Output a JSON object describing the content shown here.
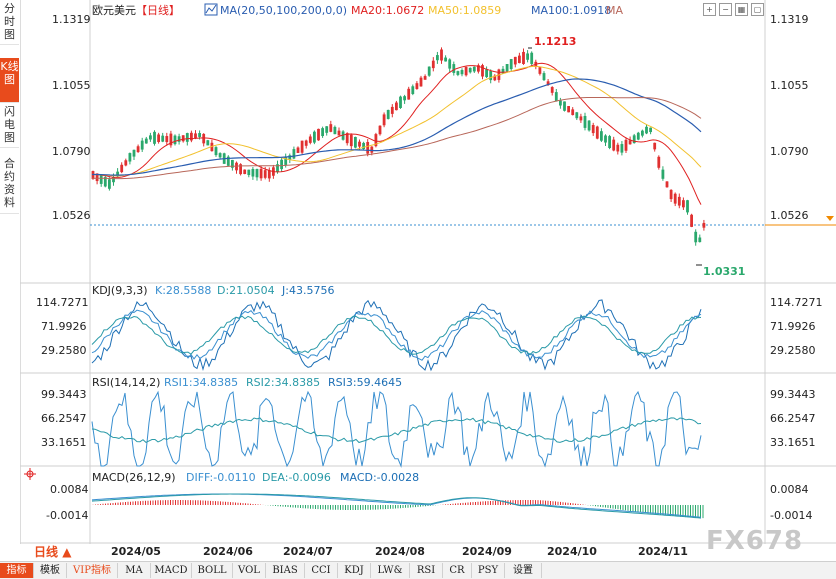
{
  "side_tabs": [
    {
      "label": "分时图",
      "active": false
    },
    {
      "label": "K线图",
      "active": true
    },
    {
      "label": "闪电图",
      "active": false
    },
    {
      "label": "合约资料",
      "active": false
    }
  ],
  "header": {
    "symbol": "欧元美元",
    "period": "【日线】",
    "ma_label": "MA(20,50,100,200,0,0)",
    "ma20": "MA20:1.0672",
    "ma50": "MA50:1.0859",
    "ma100": "MA100:1.0918",
    "ma200": "MA"
  },
  "colors": {
    "ma20": "#e02020",
    "ma50": "#f2c12e",
    "ma100": "#2a5db0",
    "ma200": "#b8675a",
    "up": "#e03030",
    "down": "#2aa86c",
    "k": "#3a8fd0",
    "d": "#2a9aa8",
    "j": "#1d6fb5"
  },
  "toolbar_icons": [
    "zoom-in-icon",
    "zoom-out-icon",
    "grid-icon",
    "expand-icon"
  ],
  "price_panel": {
    "ticks": [
      "1.1319",
      "1.1055",
      "1.0790",
      "1.0526"
    ],
    "high_label": "1.1213",
    "low_label": "1.0331",
    "current": "1.0526"
  },
  "kdj": {
    "label": "KDJ(9,3,3)",
    "k": "K:28.5588",
    "d": "D:21.0504",
    "j": "J:43.5756",
    "ticks": [
      "114.7271",
      "71.9926",
      "29.2580"
    ]
  },
  "rsi": {
    "label": "RSI(14,14,2)",
    "r1": "RSI1:34.8385",
    "r2": "RSI2:34.8385",
    "r3": "RSI3:59.4645",
    "ticks": [
      "99.3443",
      "66.2547",
      "33.1651"
    ]
  },
  "macd": {
    "label": "MACD(26,12,9)",
    "diff": "DIFF:-0.0110",
    "dea": "DEA:-0.0096",
    "macd": "MACD:-0.0028",
    "ticks": [
      "0.0084",
      "-0.0014"
    ]
  },
  "dates": [
    "2024/05",
    "2024/06",
    "2024/07",
    "2024/08",
    "2024/09",
    "2024/10",
    "2024/11"
  ],
  "period_selector": "日线",
  "bottom_tabs": [
    "指标",
    "模板",
    "VIP指标",
    "MA",
    "MACD",
    "BOLL",
    "VOL",
    "BIAS",
    "CCI",
    "KDJ",
    "LW&",
    "RSI",
    "CR",
    "PSY",
    "设置"
  ],
  "watermark": "FX678",
  "chart_data": {
    "type": "candlestick",
    "title": "欧元美元【日线】",
    "ylim": [
      1.0331,
      1.1319
    ],
    "x_labels": [
      "2024/05",
      "2024/06",
      "2024/07",
      "2024/08",
      "2024/09",
      "2024/10",
      "2024/11"
    ],
    "series": [
      {
        "name": "MA20",
        "value": 1.0672
      },
      {
        "name": "MA50",
        "value": 1.0859
      },
      {
        "name": "MA100",
        "value": 1.0918
      }
    ],
    "annotations": {
      "high": 1.1213,
      "low": 1.0331,
      "last": 1.0526
    }
  }
}
